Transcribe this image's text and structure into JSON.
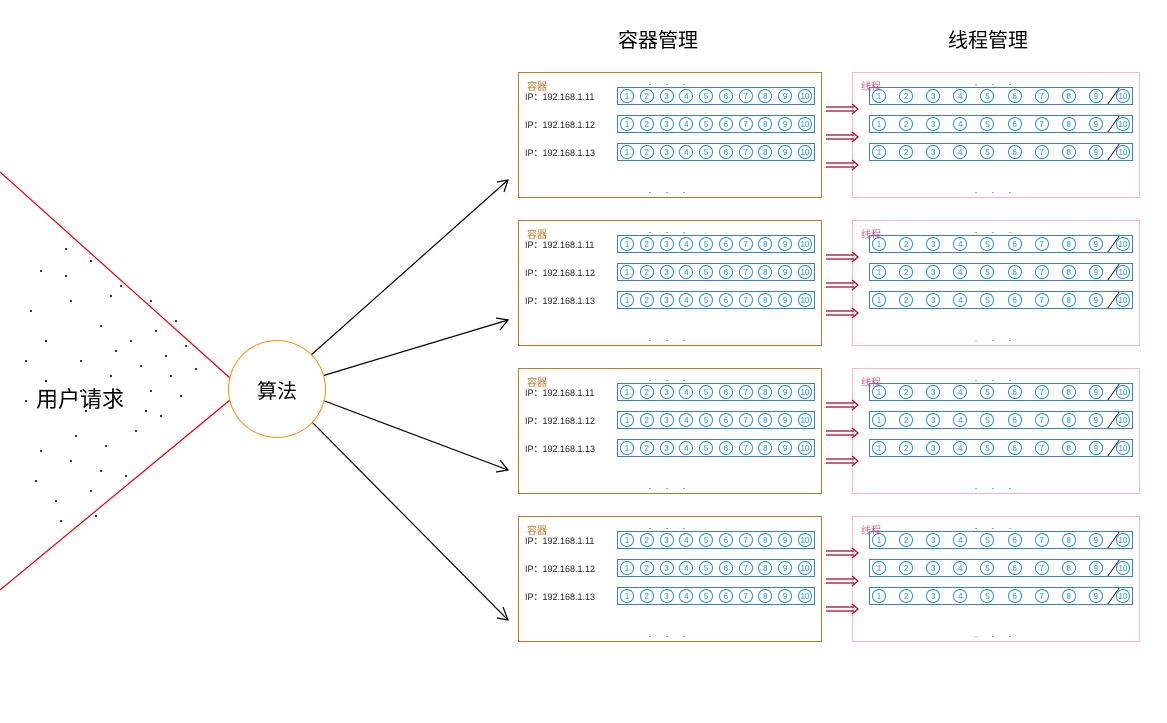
{
  "headers": {
    "container_mgmt": "容器管理",
    "thread_mgmt": "线程管理"
  },
  "user_request": "用户请求",
  "algorithm": "算法",
  "box_labels": {
    "container": "容器",
    "thread": "线程"
  },
  "ellipsis": ". . .",
  "ips": [
    "IP：192.168.1.11",
    "IP：192.168.1.12",
    "IP：192.168.1.13"
  ],
  "circle_numbers": [
    1,
    2,
    3,
    4,
    5,
    6,
    7,
    8,
    9,
    10
  ],
  "group_count": 4
}
